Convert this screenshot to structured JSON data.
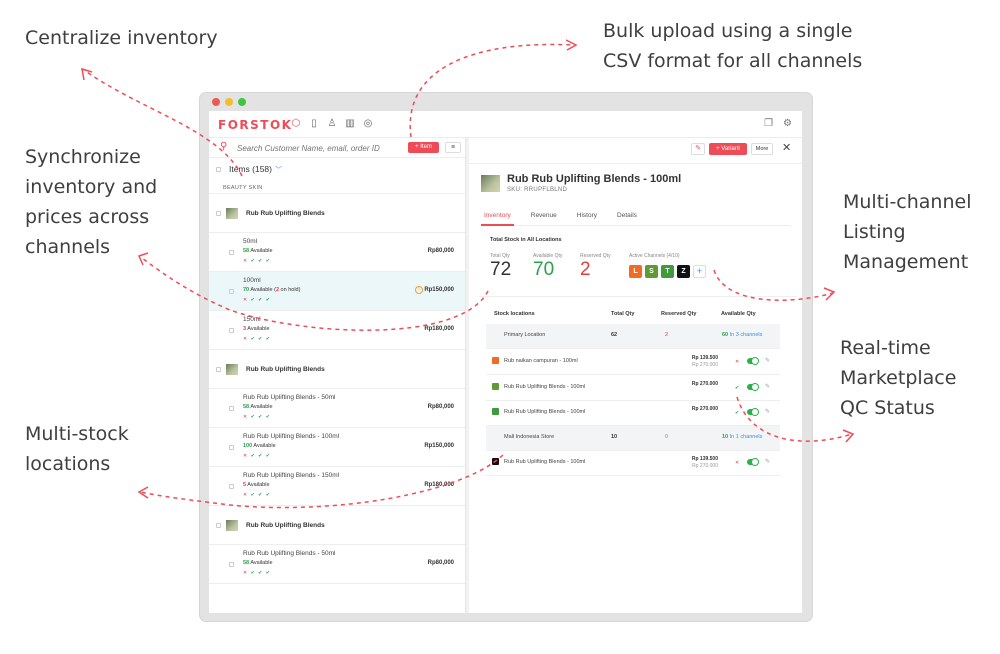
{
  "callouts": {
    "centralize": "Centralize inventory",
    "bulk_1": "Bulk upload using a single",
    "bulk_2": "CSV format for all channels",
    "sync_1": "Synchronize",
    "sync_2": "inventory and",
    "sync_3": "prices across",
    "sync_4": "channels",
    "multichannel_1": "Multi-channel",
    "multichannel_2": "Listing",
    "multichannel_3": "Management",
    "qc_1": "Real-time",
    "qc_2": "Marketplace",
    "qc_3": "QC Status",
    "multistock_1": "Multi-stock",
    "multistock_2": "locations"
  },
  "colors": {
    "brand": "#ef4b57",
    "available": "#2aa14a",
    "link": "#3a8ee6"
  },
  "app": {
    "logo": "FORSTOK",
    "nav_icons": [
      "box-icon",
      "clipboard-icon",
      "user-icon",
      "chart-icon",
      "settings-circle-icon"
    ],
    "search": {
      "placeholder": "Search Customer Name, email, order ID"
    },
    "add_item_label": "+ Item",
    "items_header": "Items (158)",
    "category": "BEAUTY SKIN",
    "groups": [
      {
        "name": "Rub Rub Uplifting Blends",
        "variants": [
          {
            "name": "50ml",
            "qty": "58",
            "avail": "Available",
            "onhold": "",
            "price": "Rp80,000"
          },
          {
            "name": "100ml",
            "qty": "70",
            "avail": "Available",
            "onhold": "(2 on hold)",
            "price": "Rp150,000"
          },
          {
            "name": "150ml",
            "qty": "3",
            "avail": "Available",
            "onhold": "",
            "price": "Rp180,000"
          }
        ]
      },
      {
        "name": "Rub Rub Uplifting Blends",
        "variants": [
          {
            "name": "Rub Rub Uplifting Blends - 50ml",
            "qty": "58",
            "avail": "Available",
            "onhold": "",
            "price": "Rp80,000"
          },
          {
            "name": "Rub Rub Uplifting Blends - 100ml",
            "qty": "100",
            "avail": "Available",
            "onhold": "",
            "price": "Rp150,000"
          },
          {
            "name": "Rub Rub Uplifting Blends - 150ml",
            "qty": "5",
            "avail": "Available",
            "onhold": "",
            "price": "Rp180,000"
          }
        ]
      },
      {
        "name": "Rub Rub Uplifting Blends",
        "variants": [
          {
            "name": "Rub Rub Uplifting Blends - 50ml",
            "qty": "58",
            "avail": "Available",
            "onhold": "",
            "price": "Rp80,000"
          }
        ]
      }
    ],
    "checks": "✕ ✔ ✔ ✔",
    "detail": {
      "variant_label": "+ Variant",
      "more_label": "More",
      "title": "Rub Rub Uplifting Blends - 100ml",
      "sku": "SKU: RRUPFLBLND",
      "tabs": [
        "Inventory",
        "Revenue",
        "History",
        "Details"
      ],
      "total_stock_title": "Total Stock in All Locations",
      "total_qty_label": "Total Qty",
      "total_qty": "72",
      "available_qty_label": "Available Qty",
      "available_qty": "70",
      "reserved_qty_label": "Reserved Qty",
      "reserved_qty": "2",
      "channels_label": "Active Channels (4/10)",
      "channels": [
        {
          "icon": "lazada-icon",
          "glyph": "L",
          "color": "#f36b21"
        },
        {
          "icon": "shopify-icon",
          "glyph": "S",
          "color": "#5e9c33"
        },
        {
          "icon": "tokopedia-icon",
          "glyph": "T",
          "color": "#3f9a3c"
        },
        {
          "icon": "zalora-icon",
          "glyph": "Z",
          "color": "#111111"
        }
      ],
      "table_headers": [
        "Stock locations",
        "Total Qty",
        "Reserved Qty",
        "Available Qty"
      ],
      "rows": [
        {
          "type": "loc",
          "name": "Primary Location",
          "qty": "62",
          "reserved": "2",
          "avail": "60",
          "avail_link": "In 3 channels"
        },
        {
          "type": "chan",
          "icon": "lazada-icon",
          "color": "#f36b21",
          "name": "Rub naikan campuran - 100ml",
          "price": "Rp 139.500",
          "strike": "Rp 270.000",
          "status": "✕",
          "status_color": "#e03e3e"
        },
        {
          "type": "chan",
          "icon": "shopify-icon",
          "color": "#5e9c33",
          "name": "Rub Rub Uplifting Blends - 100ml",
          "price": "Rp 270.000",
          "strike": "",
          "status": "✔",
          "status_color": "#2aa14a"
        },
        {
          "type": "chan",
          "icon": "tokopedia-icon",
          "color": "#3f9a3c",
          "name": "Rub Rub Uplifting Blends - 100ml",
          "price": "Rp 270.000",
          "strike": "",
          "status": "✔",
          "status_color": "#2aa14a"
        },
        {
          "type": "loc",
          "name": "Mall Indonesia Store",
          "qty": "10",
          "reserved": "0",
          "avail": "10",
          "avail_link": "In 1 channels"
        },
        {
          "type": "chan",
          "icon": "zalora-icon",
          "color": "#111111",
          "name": "Rub Rub Uplifting Blends - 100ml",
          "price": "Rp 139.500",
          "strike": "Rp 270.000",
          "status": "✕",
          "status_color": "#e03e3e"
        }
      ]
    }
  }
}
